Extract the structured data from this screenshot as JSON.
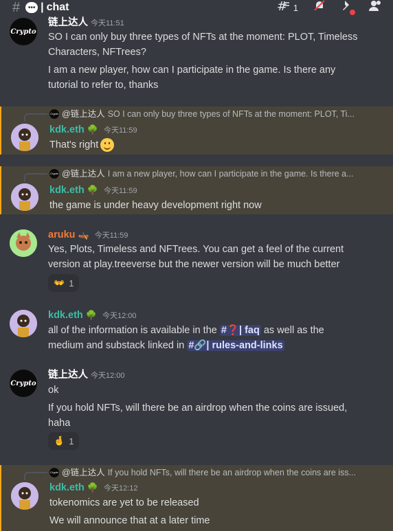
{
  "topbar": {
    "channel": "chat",
    "threads_count": "1"
  },
  "users": {
    "crypto": "链上达人",
    "kdk": "kdk.eth",
    "aruku": "aruku"
  },
  "avatar_text": "Crypto",
  "messages": {
    "m1": {
      "time": "今天11:51",
      "line1": "SO I can only buy three types of NFTs at the moment: PLOT, Timeless",
      "line2": "Characters, NFTrees?",
      "line3": "I am a new player, how can I participate in the game. Is there any",
      "line4": "tutorial to refer to, thanks"
    },
    "m2": {
      "reply_name": "@链上达人",
      "reply_text": "SO I can only buy three types of NFTs at the moment: PLOT, Ti...",
      "time": "今天11:59",
      "text": "That's right"
    },
    "m3": {
      "reply_name": "@链上达人",
      "reply_text": "I am a new player, how can I participate in the game. Is there a...",
      "time": "今天11:59",
      "text": "the game is under heavy development right now"
    },
    "m4": {
      "time": "今天11:59",
      "line1": "Yes, Plots, Timeless and NFTrees. You can get a feel of the current",
      "line2": "version at play.treeverse but the newer version will be much better",
      "reaction_count": "1"
    },
    "m5": {
      "time": "今天12:00",
      "pre1": "all of the information is available in the ",
      "mention1": "#❓| faq",
      "post1": " as well as the",
      "pre2": "medium and substack linked in ",
      "mention2": "#🔗| rules-and-links"
    },
    "m6": {
      "time": "今天12:00",
      "line1": "ok",
      "line2": "If you hold NFTs, will there be an airdrop when the coins are issued,",
      "line3": "haha",
      "reaction_count": "1"
    },
    "m7": {
      "reply_name": "@链上达人",
      "reply_text": "If you hold NFTs, will there be an airdrop when the coins are iss...",
      "time": "今天12:12",
      "line1": "tokenomics are yet to be released",
      "line2": "We will announce that at a later time"
    }
  }
}
